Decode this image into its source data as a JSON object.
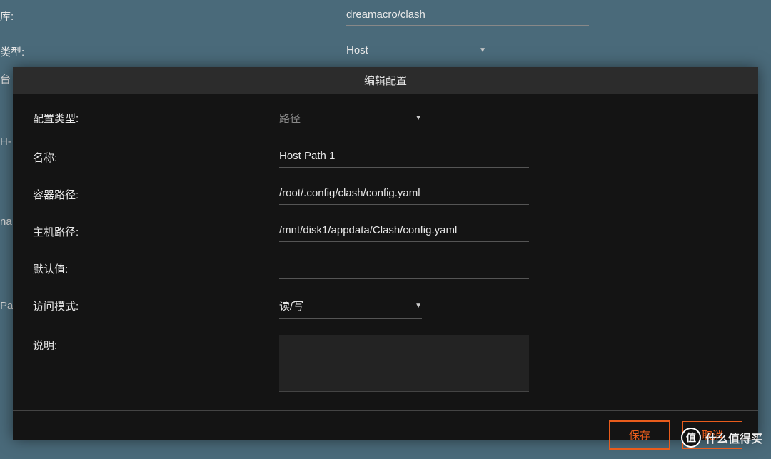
{
  "background": {
    "row1_label": "库:",
    "row1_value": "dreamacro/clash",
    "row2_label": "类型:",
    "row2_value": "Host",
    "peek1": "台",
    "peek2": "H-",
    "peek3": "na",
    "peek4": "Pa"
  },
  "modal": {
    "title": "编辑配置",
    "labels": {
      "config_type": "配置类型:",
      "name": "名称:",
      "container_path": "容器路径:",
      "host_path": "主机路径:",
      "default_value": "默认值:",
      "access_mode": "访问模式:",
      "description": "说明:"
    },
    "values": {
      "config_type": "路径",
      "name": "Host Path 1",
      "container_path": "/root/.config/clash/config.yaml",
      "host_path": "/mnt/disk1/appdata/Clash/config.yaml",
      "default_value": "",
      "access_mode": "读/写",
      "description": ""
    },
    "buttons": {
      "save": "保存",
      "cancel": "取消"
    }
  },
  "watermark": {
    "icon": "值",
    "text": "什么值得买"
  }
}
